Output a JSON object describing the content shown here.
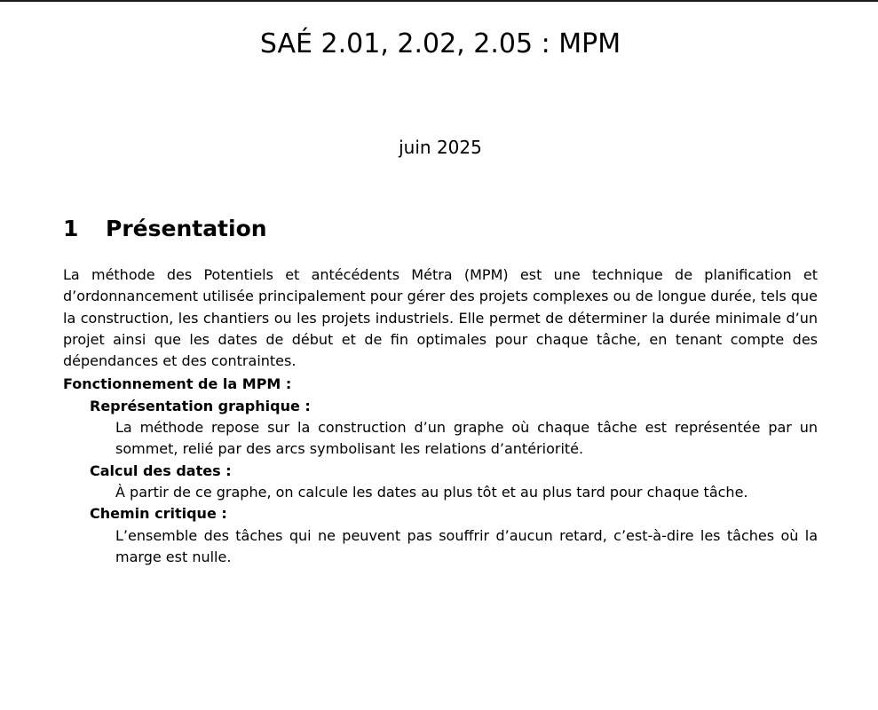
{
  "document": {
    "title": "SAÉ 2.01, 2.02, 2.05 : MPM",
    "date": "juin 2025"
  },
  "section": {
    "number": "1",
    "title": "Présentation",
    "intro": "La méthode des Potentiels et antécédents Métra (MPM) est une technique de planification et d’ordonnancement utilisée principalement pour gérer des projets complexes ou de longue durée, tels que la construction, les chantiers ou les projets industriels. Elle permet de déterminer la durée minimale d’un projet ainsi que les dates de début et de fin optimales pour chaque tâche, en tenant compte des dépendances et des contraintes.",
    "list_title": "Fonctionnement de la MPM :",
    "items": [
      {
        "term": "Représentation graphique :",
        "description": "La méthode repose sur la construction d’un graphe où chaque tâche est représentée par un sommet, relié par des arcs symbolisant les relations d’antériorité."
      },
      {
        "term": "Calcul des dates :",
        "description": "À partir de ce graphe, on calcule les dates au plus tôt et au plus tard pour chaque tâche."
      },
      {
        "term": "Chemin critique :",
        "description": "L’ensemble des tâches qui ne peuvent pas souffrir d’aucun retard, c’est-à-dire les tâches où la marge est nulle."
      }
    ]
  }
}
